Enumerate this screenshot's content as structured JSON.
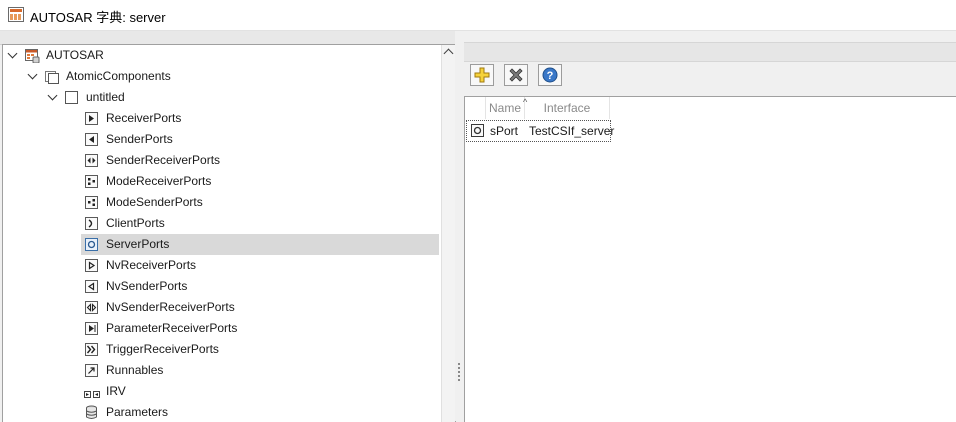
{
  "window": {
    "title": "AUTOSAR 字典: server"
  },
  "tree": {
    "root": {
      "label": "AUTOSAR"
    },
    "atomic": {
      "label": "AtomicComponents"
    },
    "component": {
      "label": "untitled"
    },
    "items": [
      {
        "label": "ReceiverPorts",
        "icon": "receiver-port-icon"
      },
      {
        "label": "SenderPorts",
        "icon": "sender-port-icon"
      },
      {
        "label": "SenderReceiverPorts",
        "icon": "sender-receiver-port-icon"
      },
      {
        "label": "ModeReceiverPorts",
        "icon": "mode-receiver-port-icon"
      },
      {
        "label": "ModeSenderPorts",
        "icon": "mode-sender-port-icon"
      },
      {
        "label": "ClientPorts",
        "icon": "client-port-icon"
      },
      {
        "label": "ServerPorts",
        "icon": "server-port-icon",
        "selected": true
      },
      {
        "label": "NvReceiverPorts",
        "icon": "nv-receiver-port-icon"
      },
      {
        "label": "NvSenderPorts",
        "icon": "nv-sender-port-icon"
      },
      {
        "label": "NvSenderReceiverPorts",
        "icon": "nv-sender-receiver-port-icon"
      },
      {
        "label": "ParameterReceiverPorts",
        "icon": "parameter-receiver-port-icon"
      },
      {
        "label": "TriggerReceiverPorts",
        "icon": "trigger-receiver-port-icon"
      },
      {
        "label": "Runnables",
        "icon": "runnable-icon"
      },
      {
        "label": "IRV",
        "icon": "irv-icon"
      },
      {
        "label": "Parameters",
        "icon": "parameters-icon"
      }
    ]
  },
  "toolbar": {
    "add_icon": "add-icon",
    "delete_icon": "delete-icon",
    "help_icon": "help-icon"
  },
  "table": {
    "columns": [
      "Name",
      "Interface"
    ],
    "rows": [
      {
        "name": "sPort",
        "interface": "TestCSIf_server",
        "icon": "server-port-icon"
      }
    ]
  }
}
